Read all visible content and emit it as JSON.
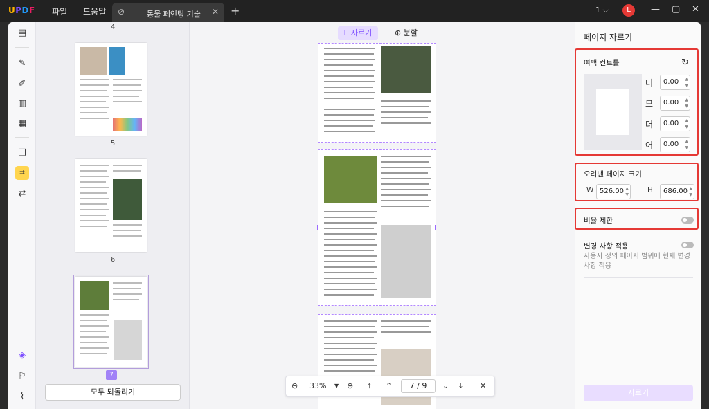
{
  "app": {
    "logo": "UPDF"
  },
  "menu": {
    "file": "파일",
    "help": "도움말"
  },
  "tab": {
    "title": "동물 페인팅 기술"
  },
  "titlebar": {
    "page_indicator": "1"
  },
  "user": {
    "avatar_initial": "L"
  },
  "thumbnails": {
    "page_labels": [
      "4",
      "5",
      "6"
    ],
    "selected_badge": "7",
    "revert_all": "모두 되돌리기"
  },
  "toolbar": {
    "crop": "자르기",
    "split": "분할"
  },
  "nav": {
    "zoom": "33%",
    "current_page": "7",
    "separator": "/",
    "total_pages": "9"
  },
  "panel": {
    "title": "페이지 자르기",
    "margin_control": {
      "label": "여백 컨트롤",
      "sides": [
        {
          "letter": "더",
          "value": "0.00"
        },
        {
          "letter": "모",
          "value": "0.00"
        },
        {
          "letter": "더",
          "value": "0.00"
        },
        {
          "letter": "어",
          "value": "0.00"
        }
      ]
    },
    "cropped_size": {
      "label": "오려낸 페이지 크기",
      "w_label": "W",
      "w_value": "526.00",
      "h_label": "H",
      "h_value": "686.00"
    },
    "ratio_lock": {
      "label": "비율 제한",
      "on": false
    },
    "apply_changes": {
      "label": "변경 사항 적용",
      "on": false,
      "description": "사용자 정의 페이지 범위에 현재 변경 사항 적용"
    },
    "crop_button": "자르기"
  },
  "colors": {
    "accent": "#7c4dff",
    "highlight_box": "#e53935",
    "tool_active": "#ffd54f"
  }
}
